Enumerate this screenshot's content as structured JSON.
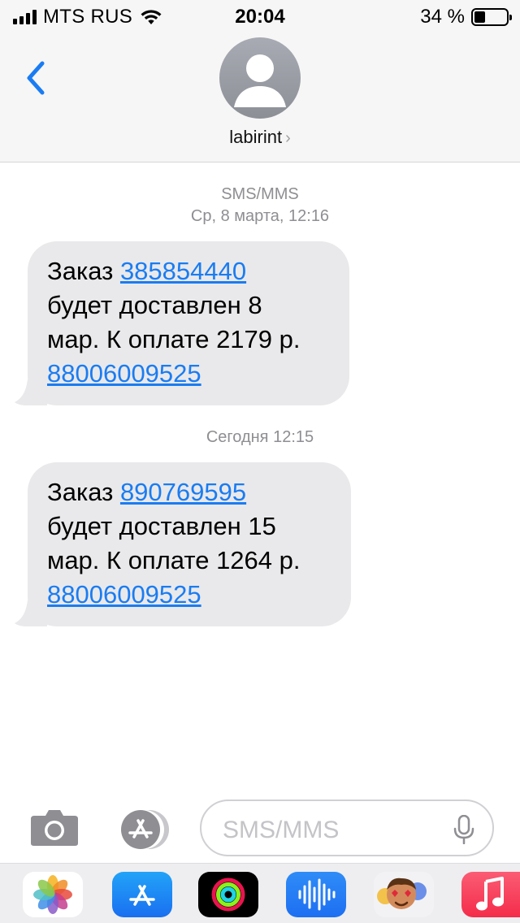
{
  "status_bar": {
    "carrier": "MTS RUS",
    "time": "20:04",
    "battery_percent": "34 %",
    "battery_level": 0.34,
    "signal_bars": 4
  },
  "nav": {
    "back_icon": "chevron-left-icon",
    "avatar_icon": "person-silhouette-icon",
    "contact_name": "labirint",
    "contact_chevron": "›"
  },
  "messages": [
    {
      "meta_type": "SMS/MMS",
      "meta_time": "Ср, 8 марта, 12:16",
      "line1_prefix": "Заказ ",
      "order_link": "385854440",
      "line2": "будет доставлен 8",
      "line3": "мар. К оплате 2179 р.",
      "phone_link": "88006009525"
    },
    {
      "meta_time": "Сегодня 12:15",
      "line1_prefix": "Заказ ",
      "order_link": "890769595",
      "line2": "будет доставлен 15",
      "line3": "мар. К оплате 1264 р.",
      "phone_link": "88006009525"
    }
  ],
  "input_bar": {
    "camera_icon": "camera-icon",
    "apps_icon": "app-store-icon",
    "placeholder": "SMS/MMS",
    "mic_icon": "microphone-icon"
  },
  "app_drawer": [
    {
      "name": "Photos",
      "icon": "photos-icon"
    },
    {
      "name": "App Store",
      "icon": "app-store-icon"
    },
    {
      "name": "Activity",
      "icon": "activity-rings-icon"
    },
    {
      "name": "Audio Message",
      "icon": "audio-waveform-icon"
    },
    {
      "name": "Memoji",
      "icon": "memoji-icon"
    },
    {
      "name": "Music",
      "icon": "music-note-icon"
    }
  ],
  "colors": {
    "link_blue": "#1a7cf2",
    "bubble_gray": "#e9e9eb",
    "meta_gray": "#8e8e93",
    "header_bg": "#f6f6f6"
  }
}
